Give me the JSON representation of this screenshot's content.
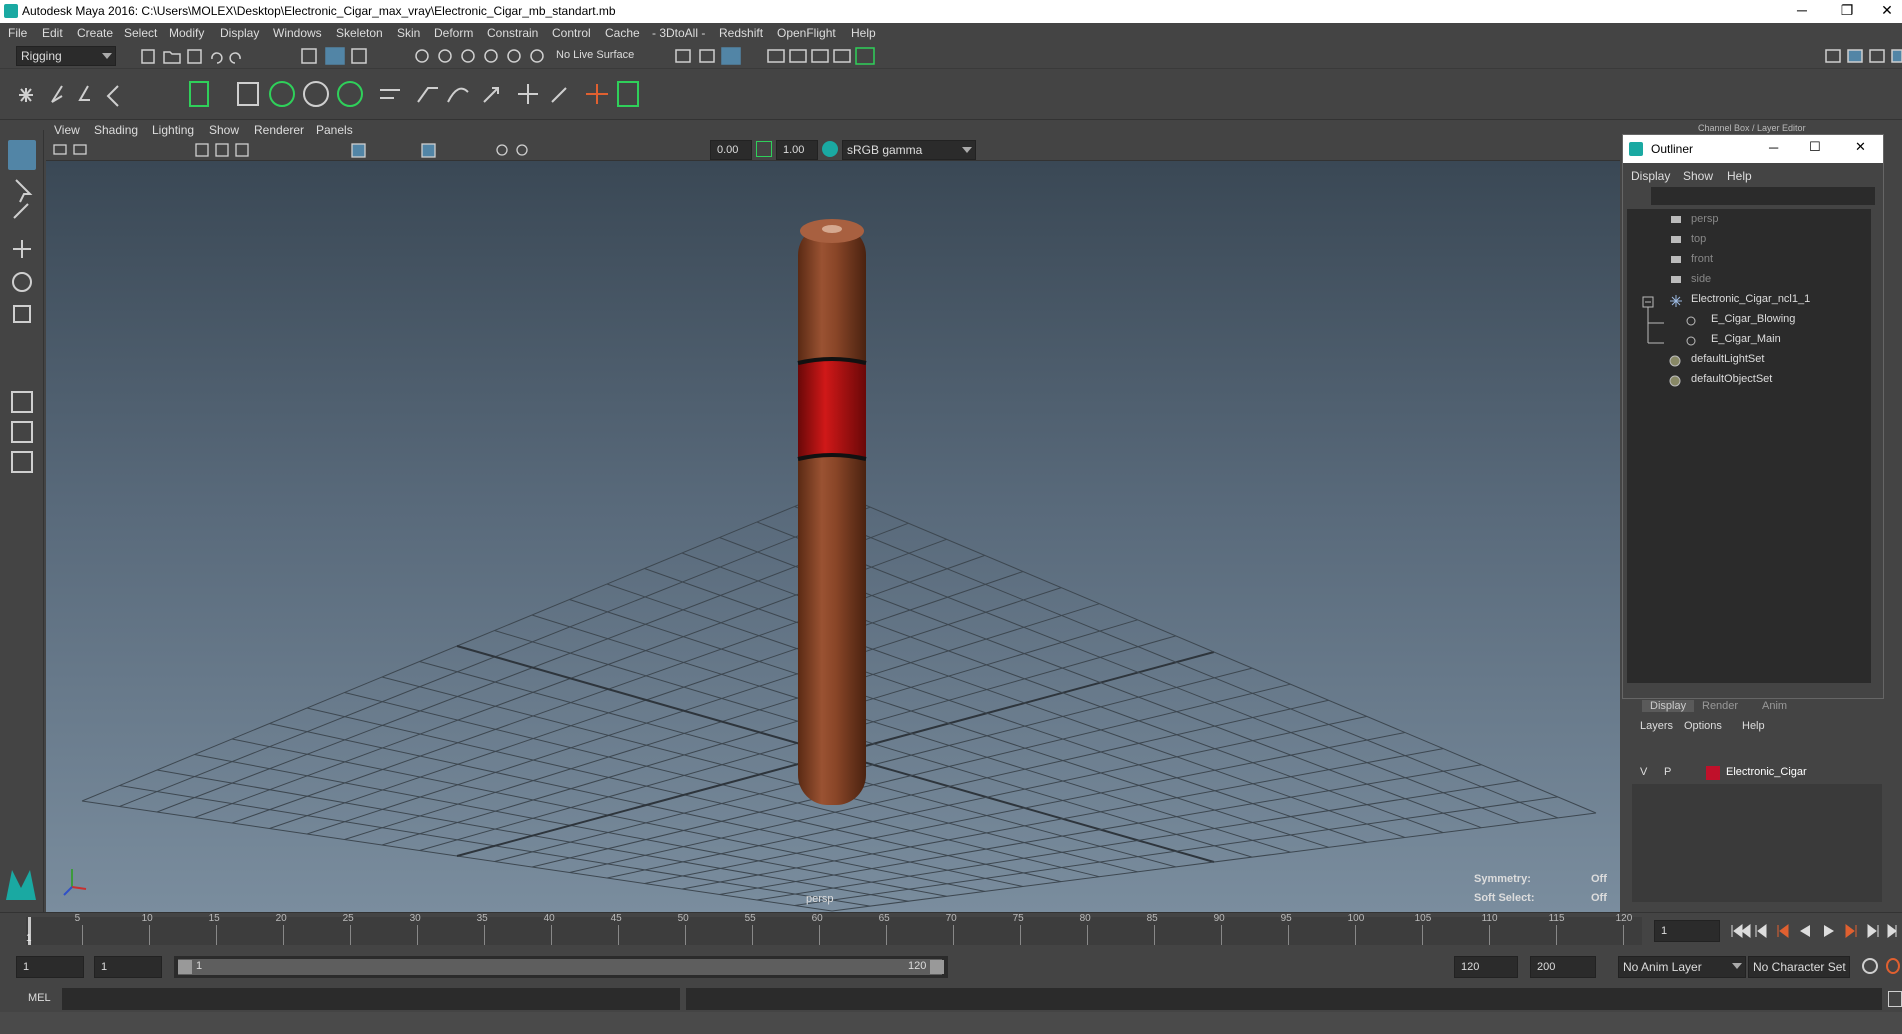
{
  "window": {
    "title": "Autodesk Maya 2016: C:\\Users\\MOLEX\\Desktop\\Electronic_Cigar_max_vray\\Electronic_Cigar_mb_standart.mb",
    "minimize": "─",
    "restore": "❐",
    "close": "✕"
  },
  "menubar": [
    "File",
    "Edit",
    "Create",
    "Select",
    "Modify",
    "Display",
    "Windows",
    "Skeleton",
    "Skin",
    "Deform",
    "Constrain",
    "Control",
    "Cache",
    "- 3DtoAll -",
    "Redshift",
    "OpenFlight",
    "Help"
  ],
  "statusline": {
    "mode": "Rigging",
    "live_surface": "No Live Surface"
  },
  "viewport_menu": [
    "View",
    "Shading",
    "Lighting",
    "Show",
    "Renderer",
    "Panels"
  ],
  "viewport_toolbar": {
    "exposure": "0.00",
    "gamma": "1.00",
    "color_space": "sRGB gamma"
  },
  "viewport": {
    "camera_label": "persp",
    "symmetry_label": "Symmetry:",
    "symmetry_value": "Off",
    "soft_select_label": "Soft Select:",
    "soft_select_value": "Off"
  },
  "right_panel": {
    "header": "Channel Box / Layer Editor"
  },
  "outliner": {
    "title": "Outliner",
    "menu": [
      "Display",
      "Show",
      "Help"
    ],
    "items": [
      {
        "label": "persp",
        "type": "camera",
        "dim": true
      },
      {
        "label": "top",
        "type": "camera",
        "dim": true
      },
      {
        "label": "front",
        "type": "camera",
        "dim": true
      },
      {
        "label": "side",
        "type": "camera",
        "dim": true
      },
      {
        "label": "Electronic_Cigar_ncl1_1",
        "type": "group",
        "dim": false
      },
      {
        "label": "E_Cigar_Blowing",
        "type": "mesh",
        "dim": false
      },
      {
        "label": "E_Cigar_Main",
        "type": "mesh",
        "dim": false
      },
      {
        "label": "defaultLightSet",
        "type": "set",
        "dim": false
      },
      {
        "label": "defaultObjectSet",
        "type": "set",
        "dim": false
      }
    ]
  },
  "layer_editor": {
    "tabs": [
      "Display",
      "Render",
      "Anim"
    ],
    "menu": [
      "Layers",
      "Options",
      "Help"
    ],
    "layer": {
      "v": "V",
      "p": "P",
      "color": "#c0102a",
      "name": "Electronic_Cigar"
    }
  },
  "timeline": {
    "ticks": [
      "5",
      "10",
      "15",
      "20",
      "25",
      "30",
      "35",
      "40",
      "45",
      "50",
      "55",
      "60",
      "65",
      "70",
      "75",
      "80",
      "85",
      "90",
      "95",
      "100",
      "105",
      "110",
      "115",
      "120"
    ],
    "current_frame_marker": "1",
    "current_frame": "1"
  },
  "range": {
    "start": "1",
    "playback_start": "1",
    "slider_start": "1",
    "slider_end": "120",
    "playback_end": "120",
    "end": "200",
    "anim_layer": "No Anim Layer",
    "character_set": "No Character Set"
  },
  "command_line": {
    "language": "MEL"
  }
}
